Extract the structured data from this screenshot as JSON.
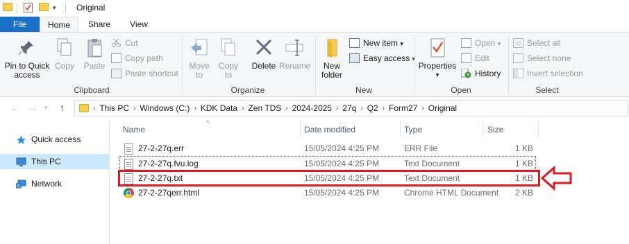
{
  "window": {
    "title": "Original"
  },
  "ribbon": {
    "tabs": [
      "File",
      "Home",
      "Share",
      "View"
    ],
    "clipboard": {
      "pin_label": "Pin to Quick access",
      "copy_label": "Copy",
      "paste_label": "Paste",
      "cut_label": "Cut",
      "copy_path_label": "Copy path",
      "paste_shortcut_label": "Paste shortcut",
      "group_label": "Clipboard"
    },
    "organize": {
      "move_to_label": "Move to",
      "copy_to_label": "Copy to",
      "delete_label": "Delete",
      "rename_label": "Rename",
      "group_label": "Organize"
    },
    "new": {
      "new_folder_label": "New folder",
      "new_item_label": "New item",
      "easy_access_label": "Easy access",
      "group_label": "New"
    },
    "open": {
      "properties_label": "Properties",
      "open_label": "Open",
      "edit_label": "Edit",
      "history_label": "History",
      "group_label": "Open"
    },
    "select": {
      "select_all_label": "Select all",
      "select_none_label": "Select none",
      "invert_label": "Invert selection",
      "group_label": "Select"
    }
  },
  "address": {
    "crumbs": [
      "This PC",
      "Windows (C:)",
      "KDK Data",
      "Zen TDS",
      "2024-2025",
      "27q",
      "Q2",
      "Form27",
      "Original"
    ]
  },
  "navpane": {
    "items": [
      {
        "label": "Quick access",
        "icon": "star-icon"
      },
      {
        "label": "This PC",
        "icon": "computer-icon",
        "selected": true
      },
      {
        "label": "Network",
        "icon": "network-icon"
      }
    ]
  },
  "filelist": {
    "columns": [
      "Name",
      "Date modified",
      "Type",
      "Size"
    ],
    "rows": [
      {
        "name": "27-2-27q.err",
        "date": "15/05/2024 4:25 PM",
        "type": "ERR File",
        "size": "1 KB",
        "icon": "file-icon"
      },
      {
        "name": "27-2-27q.fvu.log",
        "date": "15/05/2024 4:25 PM",
        "type": "Text Document",
        "size": "1 KB",
        "icon": "text-file-icon"
      },
      {
        "name": "27-2-27q.txt",
        "date": "15/05/2024 4:25 PM",
        "type": "Text Document",
        "size": "1 KB",
        "icon": "text-file-icon",
        "highlighted": true
      },
      {
        "name": "27-2-27qerr.html",
        "date": "15/05/2024 4:25 PM",
        "type": "Chrome HTML Document",
        "size": "2 KB",
        "icon": "chrome-icon"
      }
    ]
  },
  "colors": {
    "accent": "#1a6fc9",
    "selection": "#cce8ff",
    "annotation": "#e0171f",
    "folder": "#f6cd55"
  }
}
